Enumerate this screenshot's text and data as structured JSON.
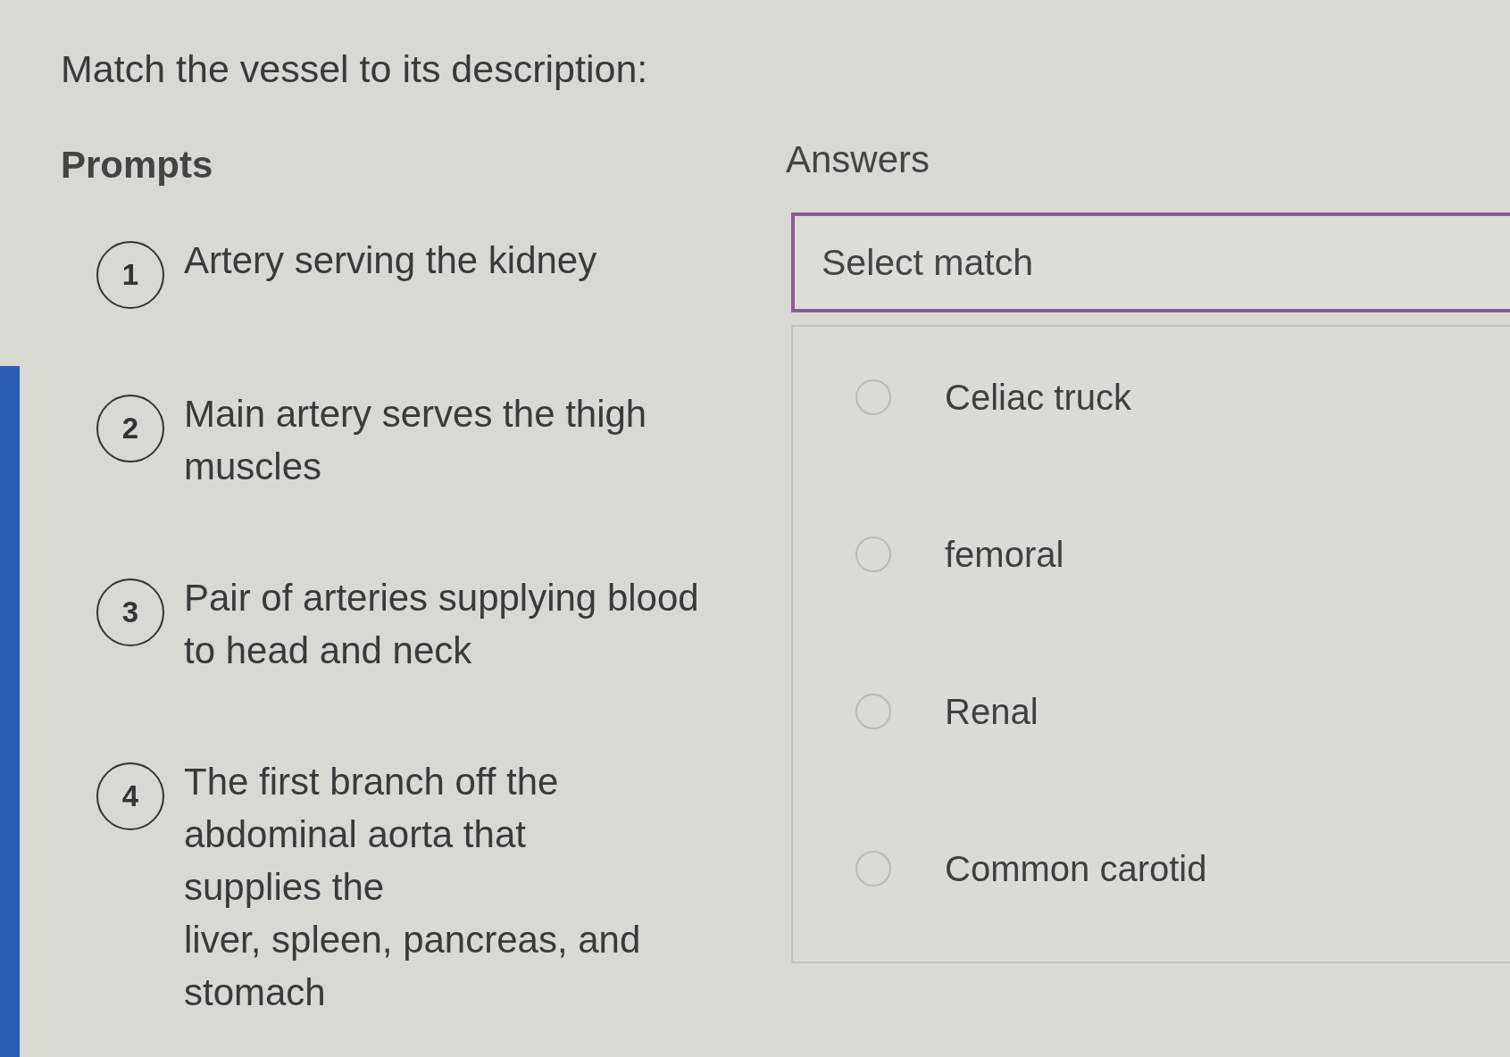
{
  "title": "Match the vessel to its description:",
  "prompts": {
    "heading": "Prompts",
    "items": [
      {
        "number": "1",
        "text": "Artery serving the kidney"
      },
      {
        "number": "2",
        "text": "Main artery serves the thigh muscles"
      },
      {
        "number": "3",
        "text": "Pair of arteries supplying blood to head and neck"
      },
      {
        "number": "4",
        "text": "The first branch off the abdominal aorta that\nsupplies the\nliver, spleen, pancreas, and stomach"
      }
    ]
  },
  "answers": {
    "heading": "Answers",
    "select": {
      "placeholder": "Select match",
      "expanded": true
    },
    "options": [
      {
        "label": "Celiac truck",
        "selected": false
      },
      {
        "label": "femoral",
        "selected": false
      },
      {
        "label": "Renal",
        "selected": false
      },
      {
        "label": "Common carotid",
        "selected": false
      }
    ]
  }
}
